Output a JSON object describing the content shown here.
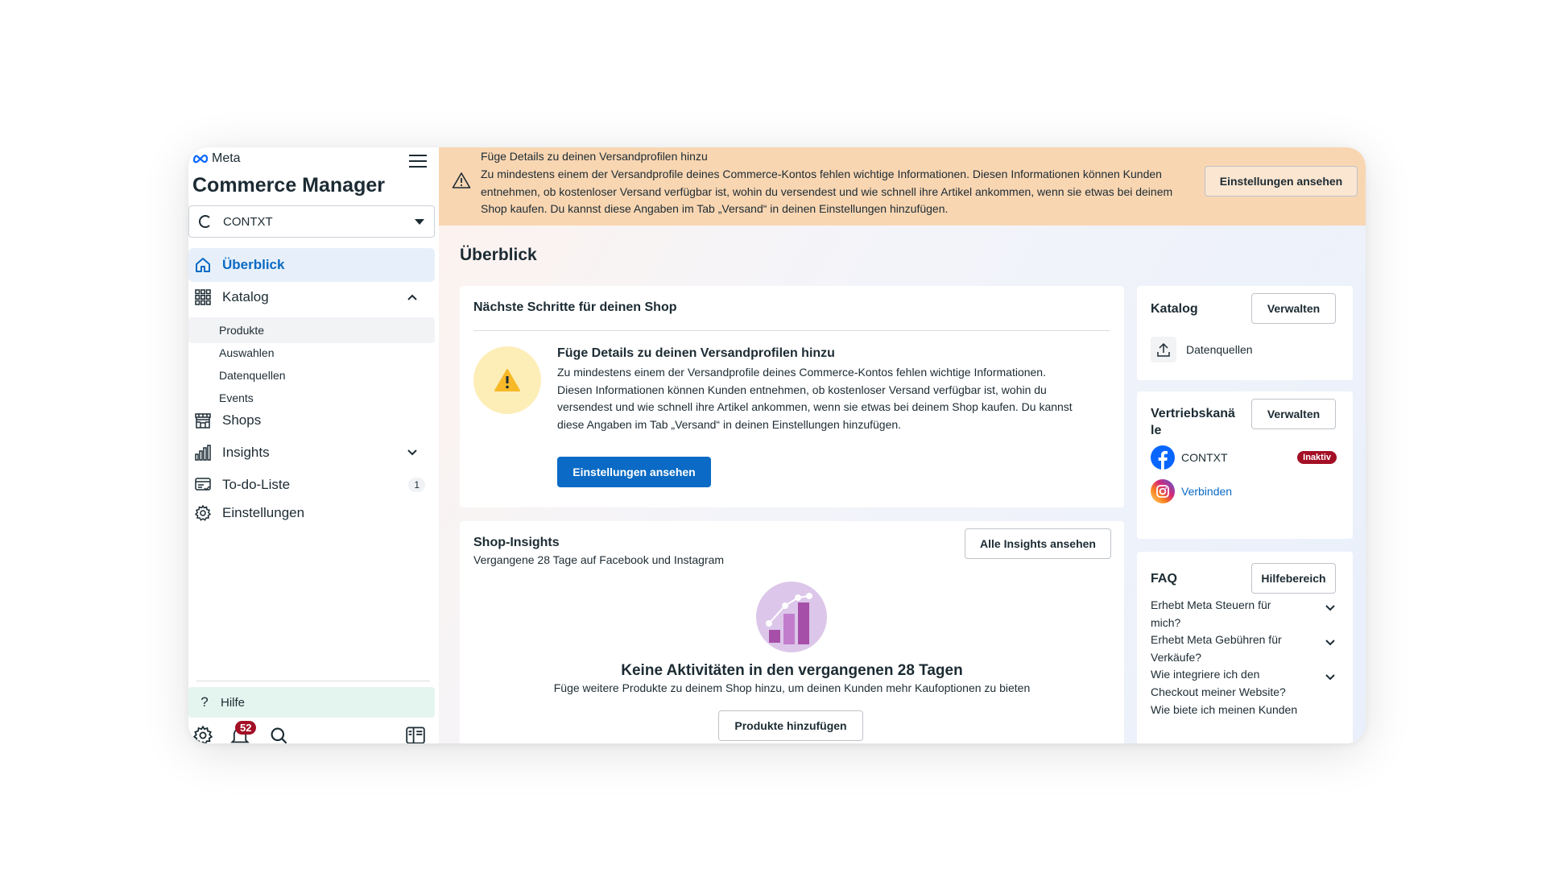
{
  "sidebar": {
    "brand": "Meta",
    "app_title": "Commerce Manager",
    "account": "CONTXT",
    "nav": {
      "overview": "Überblick",
      "catalog": "Katalog",
      "sub_products": "Produkte",
      "sub_sets": "Auswahlen",
      "sub_sources": "Datenquellen",
      "sub_events": "Events",
      "shops": "Shops",
      "insights": "Insights",
      "todo": "To-do-Liste",
      "todo_count": "1",
      "settings": "Einstellungen"
    },
    "help": "Hilfe",
    "notification_count": "52"
  },
  "banner": {
    "title": "Füge Details zu deinen Versandprofilen hinzu",
    "text": "Zu mindestens einem der Versandprofile deines Commerce-Kontos fehlen wichtige Informationen. Diesen Informationen können Kunden entnehmen, ob kostenloser Versand verfügbar ist, wohin du versendest und wie schnell ihre Artikel ankommen, wenn sie etwas bei deinem Shop kaufen. Du kannst diese Angaben im Tab „Versand“ in deinen Einstellungen hinzufügen.",
    "button": "Einstellungen ansehen"
  },
  "main": {
    "page_title": "Überblick",
    "steps": {
      "title": "Nächste Schritte für deinen Shop",
      "item_title": "Füge Details zu deinen Versandprofilen hinzu",
      "item_text": "Zu mindestens einem der Versandprofile deines Commerce-Kontos fehlen wichtige Informationen. Diesen Informationen können Kunden entnehmen, ob kostenloser Versand verfügbar ist, wohin du versendest und wie schnell ihre Artikel ankommen, wenn sie etwas bei deinem Shop kaufen. Du kannst diese Angaben im Tab „Versand“ in deinen Einstellungen hinzufügen.",
      "button": "Einstellungen ansehen"
    },
    "insights": {
      "title": "Shop-Insights",
      "subtitle": "Vergangene 28 Tage auf Facebook und Instagram",
      "all_button": "Alle Insights ansehen",
      "empty_title": "Keine Aktivitäten in den vergangenen 28 Tagen",
      "empty_text": "Füge weitere Produkte zu deinem Shop hinzu, um deinen Kunden mehr Kaufoptionen zu bieten",
      "add_button": "Produkte hinzufügen"
    }
  },
  "right": {
    "catalog": {
      "title": "Katalog",
      "manage": "Verwalten",
      "data_sources": "Datenquellen"
    },
    "channels": {
      "title_line1": "Vertriebskanä",
      "title_line2": "le",
      "manage": "Verwalten",
      "facebook_name": "CONTXT",
      "facebook_status": "Inaktiv",
      "instagram_action": "Verbinden"
    },
    "faq": {
      "title": "FAQ",
      "help_button": "Hilfebereich",
      "items": [
        "Erhebt Meta Steuern für mich?",
        "Erhebt Meta Gebühren für Verkäufe?",
        "Wie integriere ich den Checkout meiner Website?",
        "Wie biete ich meinen Kunden"
      ]
    }
  },
  "colors": {
    "accent": "#0a6ac5",
    "banner_bg": "#f9d6b2",
    "badge_red": "#a30f25",
    "active_nav_bg": "#e7f0fa"
  }
}
